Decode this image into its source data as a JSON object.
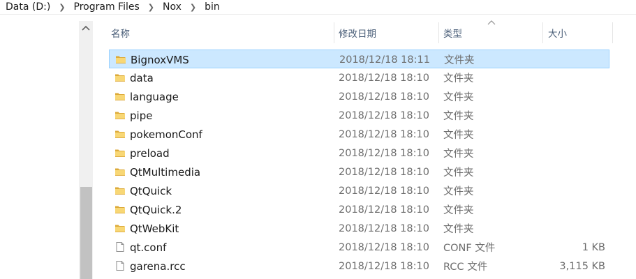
{
  "breadcrumb": [
    "Data (D:)",
    "Program Files",
    "Nox",
    "bin"
  ],
  "columns": {
    "name": "名称",
    "date": "修改日期",
    "type": "类型",
    "size": "大小"
  },
  "rows": [
    {
      "name": "BignoxVMS",
      "date": "2018/12/18 18:11",
      "type": "文件夹",
      "size": "",
      "icon": "folder-icon",
      "selected": true
    },
    {
      "name": "data",
      "date": "2018/12/18 18:10",
      "type": "文件夹",
      "size": "",
      "icon": "folder-icon"
    },
    {
      "name": "language",
      "date": "2018/12/18 18:10",
      "type": "文件夹",
      "size": "",
      "icon": "folder-icon"
    },
    {
      "name": "pipe",
      "date": "2018/12/18 18:10",
      "type": "文件夹",
      "size": "",
      "icon": "folder-icon"
    },
    {
      "name": "pokemonConf",
      "date": "2018/12/18 18:10",
      "type": "文件夹",
      "size": "",
      "icon": "folder-icon"
    },
    {
      "name": "preload",
      "date": "2018/12/18 18:10",
      "type": "文件夹",
      "size": "",
      "icon": "folder-icon"
    },
    {
      "name": "QtMultimedia",
      "date": "2018/12/18 18:10",
      "type": "文件夹",
      "size": "",
      "icon": "folder-icon"
    },
    {
      "name": "QtQuick",
      "date": "2018/12/18 18:10",
      "type": "文件夹",
      "size": "",
      "icon": "folder-icon"
    },
    {
      "name": "QtQuick.2",
      "date": "2018/12/18 18:10",
      "type": "文件夹",
      "size": "",
      "icon": "folder-icon"
    },
    {
      "name": "QtWebKit",
      "date": "2018/12/18 18:10",
      "type": "文件夹",
      "size": "",
      "icon": "folder-icon"
    },
    {
      "name": "qt.conf",
      "date": "2018/12/18 18:10",
      "type": "CONF 文件",
      "size": "1 KB",
      "icon": "file-icon"
    },
    {
      "name": "garena.rcc",
      "date": "2018/12/18 18:10",
      "type": "RCC 文件",
      "size": "3,115 KB",
      "icon": "file-icon"
    }
  ],
  "colors": {
    "selection_bg": "#cce8ff",
    "selection_border": "#99d1ff",
    "folder": "#f5c64e",
    "header_text": "#4c607a"
  }
}
